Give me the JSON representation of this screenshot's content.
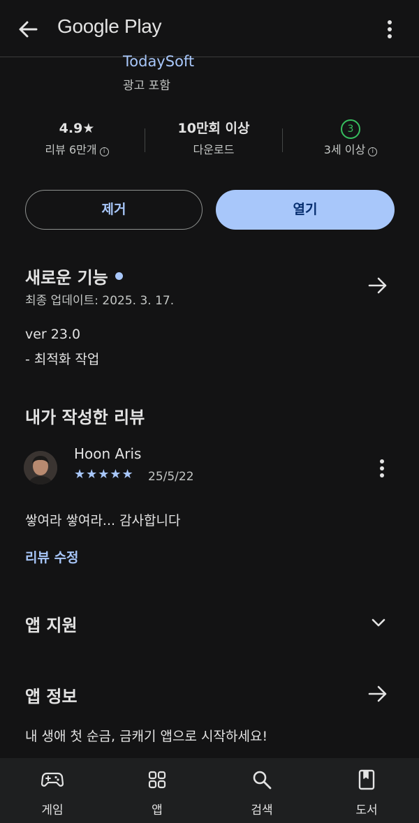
{
  "topbar": {
    "brand": "Google Play"
  },
  "app": {
    "developer": "TodaySoft",
    "ads_label": "광고 포함"
  },
  "stats": {
    "rating": "4.9★",
    "reviews_label": "리뷰 6만개",
    "downloads": "10만회 이상",
    "downloads_label": "다운로드",
    "age_badge": "3",
    "age_label": "3세 이상"
  },
  "actions": {
    "remove_label": "제거",
    "open_label": "열기"
  },
  "whats_new": {
    "title": "새로운 기능",
    "updated": "최종 업데이트: 2025. 3. 17.",
    "line1": "ver 23.0",
    "line2": "- 최적화 작업"
  },
  "my_review": {
    "title": "내가 작성한 리뷰",
    "reviewer": "Hoon Aris",
    "stars": "★★★★★",
    "rating": 5,
    "date": "25/5/22",
    "text": "쌓여라 쌓여라... 감사합니다",
    "edit_label": "리뷰 수정"
  },
  "app_support": {
    "title": "앱 지원"
  },
  "app_info": {
    "title": "앱 정보",
    "description": "내 생애 첫 순금, 금캐기 앱으로 시작하세요!"
  },
  "bottom_nav": {
    "items": [
      {
        "label": "게임",
        "icon": "gamepad-icon"
      },
      {
        "label": "앱",
        "icon": "apps-grid-icon"
      },
      {
        "label": "검색",
        "icon": "search-icon"
      },
      {
        "label": "도서",
        "icon": "book-icon"
      }
    ]
  },
  "colors": {
    "background": "#131314",
    "accent": "#a8c7fa",
    "age_green": "#37be5f",
    "nav_bg": "#1e1f20"
  }
}
